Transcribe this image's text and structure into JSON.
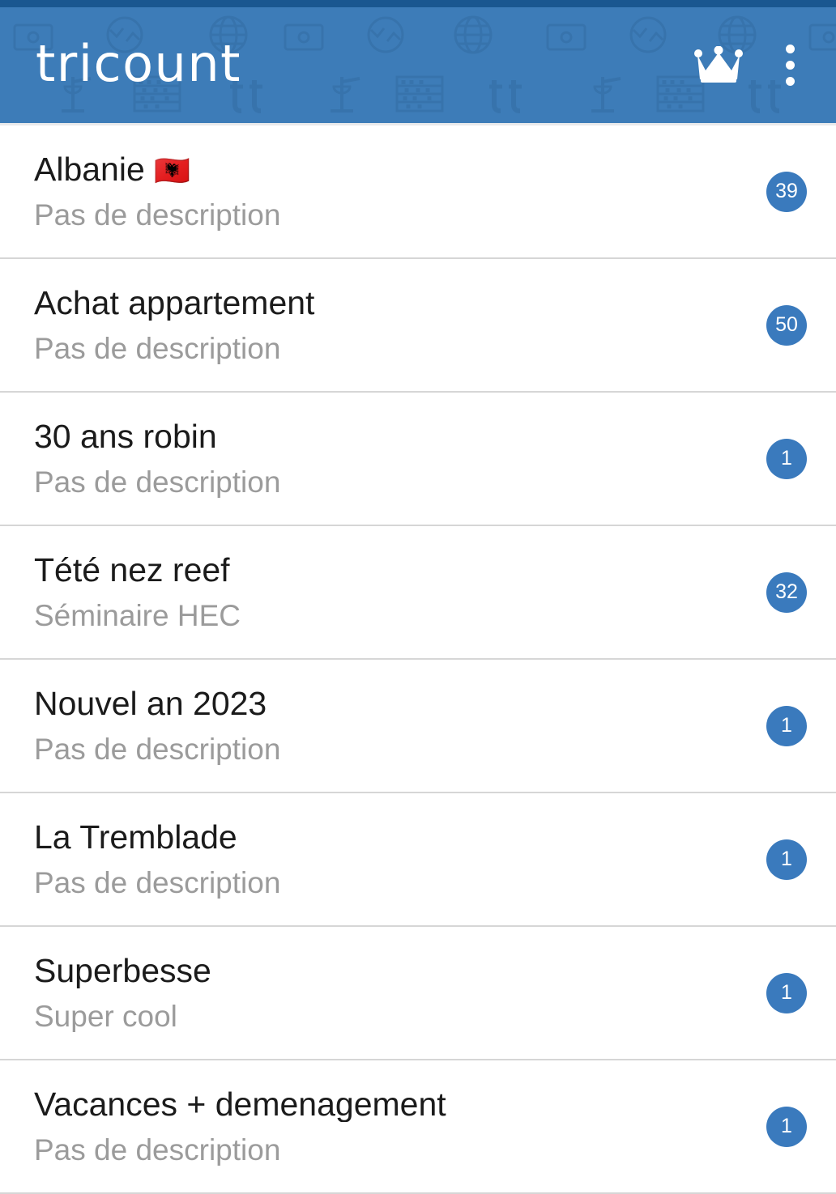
{
  "app": {
    "brand": "tricount",
    "accent_color": "#3d7cb8",
    "statusbar_color": "#1a5790",
    "badge_color": "#3a7abd",
    "title_color": "#1b1b1b",
    "subtitle_color": "#9b9b9b"
  },
  "appbar": {
    "crown_icon": "crown-icon",
    "overflow_icon": "more-vert-icon",
    "watermark_icons": [
      "banknote-icon",
      "exchange-arrows-icon",
      "globe-icon",
      "balance-scale-icon",
      "abacus-icon",
      "tt-letters-icon"
    ]
  },
  "list": {
    "items": [
      {
        "title": "Albanie",
        "flag": "🇦🇱",
        "subtitle": "Pas de description",
        "badge": "39"
      },
      {
        "title": "Achat appartement",
        "flag": "",
        "subtitle": "Pas de description",
        "badge": "50"
      },
      {
        "title": "30 ans robin",
        "flag": "",
        "subtitle": "Pas de description",
        "badge": "1"
      },
      {
        "title": "Tété nez reef",
        "flag": "",
        "subtitle": "Séminaire HEC",
        "badge": "32"
      },
      {
        "title": "Nouvel an 2023",
        "flag": "",
        "subtitle": "Pas de description",
        "badge": "1"
      },
      {
        "title": "La Tremblade",
        "flag": "",
        "subtitle": "Pas de description",
        "badge": "1"
      },
      {
        "title": "Superbesse",
        "flag": "",
        "subtitle": "Super cool",
        "badge": "1"
      },
      {
        "title": "Vacances + demenagement",
        "flag": "",
        "subtitle": "Pas de description",
        "badge": "1"
      }
    ]
  }
}
